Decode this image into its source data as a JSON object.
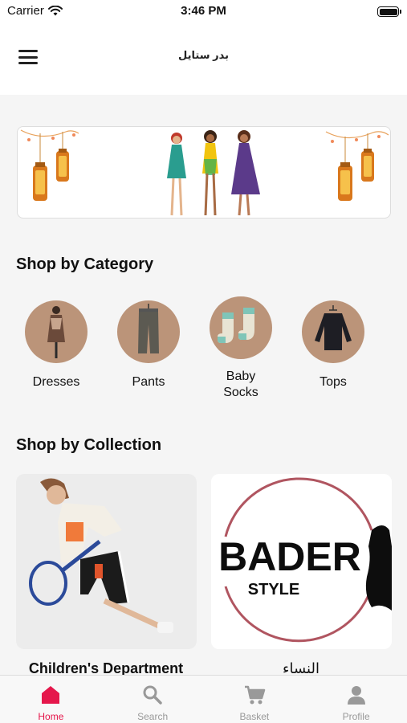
{
  "status_bar": {
    "carrier": "Carrier",
    "time": "3:46 PM"
  },
  "header": {
    "title": "بدر ستايل"
  },
  "sections": {
    "category_title": "Shop by Category",
    "collection_title": "Shop by Collection"
  },
  "categories": [
    {
      "label": "Dresses",
      "icon": "dress-thumbnail"
    },
    {
      "label": "Pants",
      "icon": "pants-thumbnail"
    },
    {
      "label": "Baby\nSocks",
      "icon": "socks-thumbnail"
    },
    {
      "label": "Tops",
      "icon": "top-thumbnail"
    }
  ],
  "collections": [
    {
      "label": "Children's Department"
    },
    {
      "label": "النساء",
      "logo_text": "BADER",
      "logo_subtext": "STYLE"
    }
  ],
  "tabs": [
    {
      "label": "Home",
      "icon": "home-icon",
      "active": true
    },
    {
      "label": "Search",
      "icon": "search-icon",
      "active": false
    },
    {
      "label": "Basket",
      "icon": "cart-icon",
      "active": false
    },
    {
      "label": "Profile",
      "icon": "person-icon",
      "active": false
    }
  ],
  "colors": {
    "accent": "#e5174b",
    "category_circle": "#bb9479",
    "inactive": "#999999"
  }
}
